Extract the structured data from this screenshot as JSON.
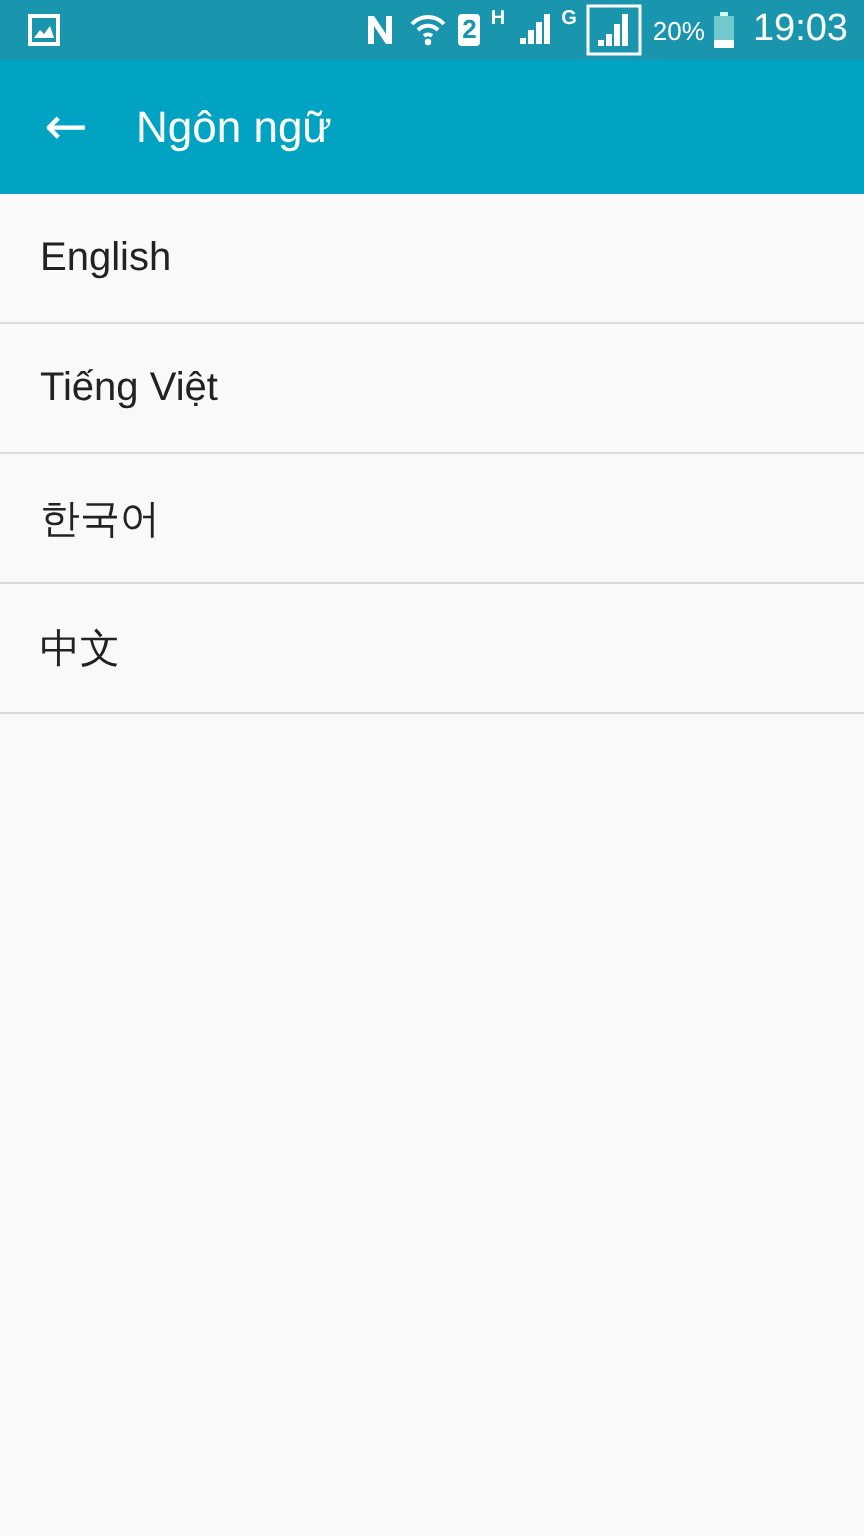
{
  "status_bar": {
    "sim_slot": "2",
    "network_1": "H",
    "network_2": "G",
    "battery": "20%",
    "time": "19:03"
  },
  "app_bar": {
    "back": "←",
    "title": "Ngôn ngữ"
  },
  "languages": [
    {
      "label": "English"
    },
    {
      "label": "Tiếng Việt"
    },
    {
      "label": "한국어"
    },
    {
      "label": "中文"
    }
  ]
}
